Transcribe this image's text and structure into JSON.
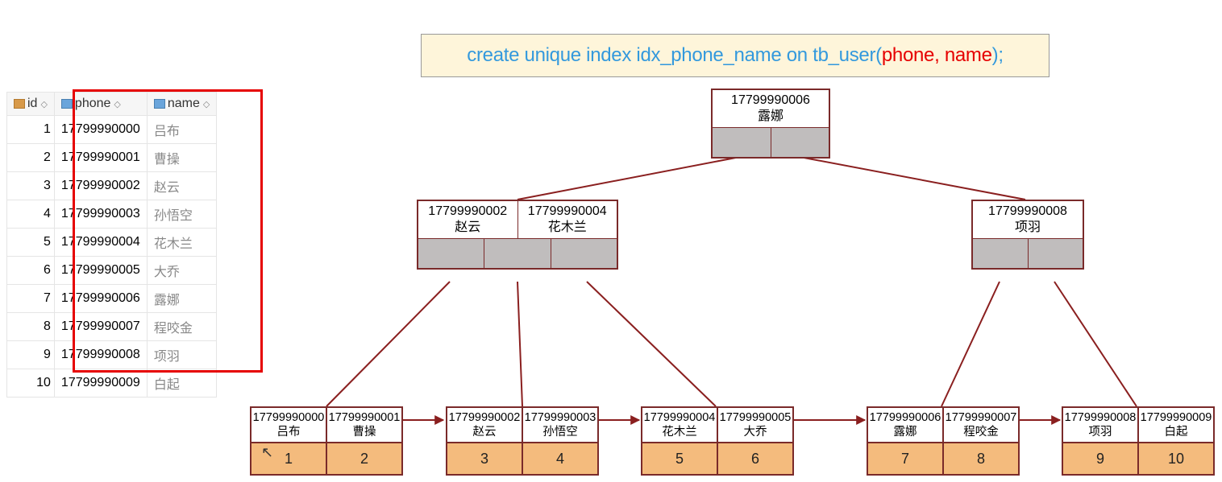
{
  "sql": {
    "part1": "create unique index idx_phone_name on tb_user(",
    "part2": "phone, name",
    "part3": ");"
  },
  "table": {
    "headers": {
      "id": "id",
      "phone": "phone",
      "name": "name"
    },
    "rows": [
      {
        "id": "1",
        "phone": "17799990000",
        "name": "吕布"
      },
      {
        "id": "2",
        "phone": "17799990001",
        "name": "曹操"
      },
      {
        "id": "3",
        "phone": "17799990002",
        "name": "赵云"
      },
      {
        "id": "4",
        "phone": "17799990003",
        "name": "孙悟空"
      },
      {
        "id": "5",
        "phone": "17799990004",
        "name": "花木兰"
      },
      {
        "id": "6",
        "phone": "17799990005",
        "name": "大乔"
      },
      {
        "id": "7",
        "phone": "17799990006",
        "name": "露娜"
      },
      {
        "id": "8",
        "phone": "17799990007",
        "name": "程咬金"
      },
      {
        "id": "9",
        "phone": "17799990008",
        "name": "项羽"
      },
      {
        "id": "10",
        "phone": "17799990009",
        "name": "白起"
      }
    ]
  },
  "tree": {
    "root": {
      "phone": "17799990006",
      "name": "露娜"
    },
    "mid_left": {
      "k1": {
        "phone": "17799990002",
        "name": "赵云"
      },
      "k2": {
        "phone": "17799990004",
        "name": "花木兰"
      }
    },
    "mid_right": {
      "k1": {
        "phone": "17799990008",
        "name": "项羽"
      }
    },
    "leaves": [
      {
        "a": {
          "phone": "17799990000",
          "name": "吕布",
          "ptr": "1"
        },
        "b": {
          "phone": "17799990001",
          "name": "曹操",
          "ptr": "2"
        }
      },
      {
        "a": {
          "phone": "17799990002",
          "name": "赵云",
          "ptr": "3"
        },
        "b": {
          "phone": "17799990003",
          "name": "孙悟空",
          "ptr": "4"
        }
      },
      {
        "a": {
          "phone": "17799990004",
          "name": "花木兰",
          "ptr": "5"
        },
        "b": {
          "phone": "17799990005",
          "name": "大乔",
          "ptr": "6"
        }
      },
      {
        "a": {
          "phone": "17799990006",
          "name": "露娜",
          "ptr": "7"
        },
        "b": {
          "phone": "17799990007",
          "name": "程咬金",
          "ptr": "8"
        }
      },
      {
        "a": {
          "phone": "17799990008",
          "name": "项羽",
          "ptr": "9"
        },
        "b": {
          "phone": "17799990009",
          "name": "白起",
          "ptr": "10"
        }
      }
    ]
  }
}
